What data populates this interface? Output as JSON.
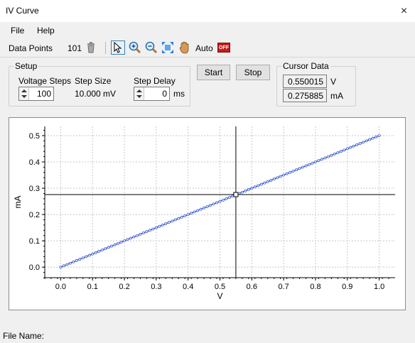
{
  "window": {
    "title": "IV Curve",
    "close_glyph": "×"
  },
  "menu": {
    "items": [
      "File",
      "Help"
    ]
  },
  "toolbar": {
    "data_points_label": "Data Points",
    "data_points_value": "101",
    "icons": [
      "trash-icon",
      "pointer-icon",
      "zoom-in-icon",
      "zoom-out-icon",
      "fit-icon",
      "pan-hand-icon"
    ],
    "auto_label": "Auto",
    "auto_toggle": "OFF"
  },
  "setup": {
    "legend": "Setup",
    "voltage_steps_label": "Voltage Steps",
    "voltage_steps_value": "100",
    "step_size_label": "Step Size",
    "step_size_value": "10.000 mV",
    "step_delay_label": "Step Delay",
    "step_delay_value": "0",
    "step_delay_unit": "ms"
  },
  "buttons": {
    "start": "Start",
    "stop": "Stop"
  },
  "cursor": {
    "legend": "Cursor Data",
    "voltage_value": "0.550015",
    "voltage_unit": "V",
    "current_value": "0.275885",
    "current_unit": "mA"
  },
  "colors": {
    "series": "#1f3fbf",
    "marker_fill": "#cfe0ff",
    "cursor": "#000000"
  },
  "chart_data": {
    "type": "line",
    "title": "",
    "xlabel": "V",
    "ylabel": "mA",
    "xlim": [
      -0.05,
      1.05
    ],
    "ylim": [
      -0.04,
      0.535
    ],
    "xticks": [
      "0.0",
      "0.1",
      "0.2",
      "0.3",
      "0.4",
      "0.5",
      "0.6",
      "0.7",
      "0.8",
      "0.9",
      "1.0"
    ],
    "yticks": [
      "0.0",
      "0.1",
      "0.2",
      "0.3",
      "0.4",
      "0.5"
    ],
    "grid": true,
    "series": [
      {
        "n_points": 101,
        "x_start": 0.0,
        "x_step": 0.01,
        "slope": 0.5
      }
    ],
    "cursor": {
      "x": 0.550015,
      "y": 0.275885
    }
  },
  "status": {
    "file_name_label": "File Name:"
  }
}
